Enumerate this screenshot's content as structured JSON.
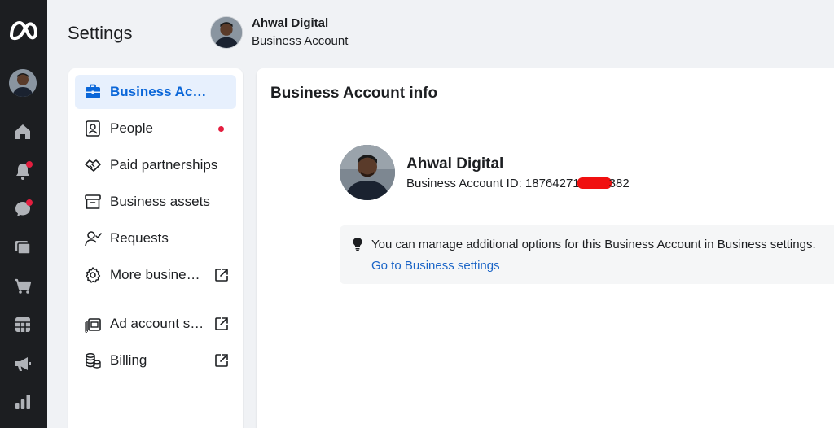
{
  "header": {
    "title": "Settings",
    "account_name": "Ahwal Digital",
    "account_type": "Business Account"
  },
  "rail": {
    "icons": [
      "meta-logo-icon",
      "home-icon",
      "notifications-icon",
      "messages-icon",
      "pages-icon",
      "shop-icon",
      "calendar-icon",
      "megaphone-icon",
      "insights-icon"
    ],
    "notification_badges": [
      "notifications-icon",
      "messages-icon"
    ]
  },
  "sidebar": {
    "items": [
      {
        "label": "Business Accou…",
        "icon": "briefcase-icon",
        "active": true
      },
      {
        "label": "People",
        "icon": "people-icon",
        "badge": "dot"
      },
      {
        "label": "Paid partnerships",
        "icon": "handshake-icon"
      },
      {
        "label": "Business assets",
        "icon": "archive-box-icon"
      },
      {
        "label": "Requests",
        "icon": "user-check-icon"
      },
      {
        "label": "More busines…",
        "icon": "gear-icon",
        "external": true
      },
      {
        "label": "Ad account s…",
        "icon": "ad-account-icon",
        "external": true
      },
      {
        "label": "Billing",
        "icon": "coins-icon",
        "external": true
      }
    ]
  },
  "main": {
    "title": "Business Account info",
    "name": "Ahwal Digital",
    "id_prefix": "Business Account ID: 18764271",
    "id_suffix": "382",
    "notice_text": "You can manage additional options for this Business Account in Business settings.",
    "notice_link": "Go to Business settings"
  },
  "colors": {
    "rail_bg": "#1c1e21",
    "page_bg": "#f0f2f5",
    "accent": "#0a66d8",
    "active_bg": "#e7f0fd",
    "badge": "#e41e3f",
    "link": "#1b65c7",
    "redaction": "#f01010"
  }
}
